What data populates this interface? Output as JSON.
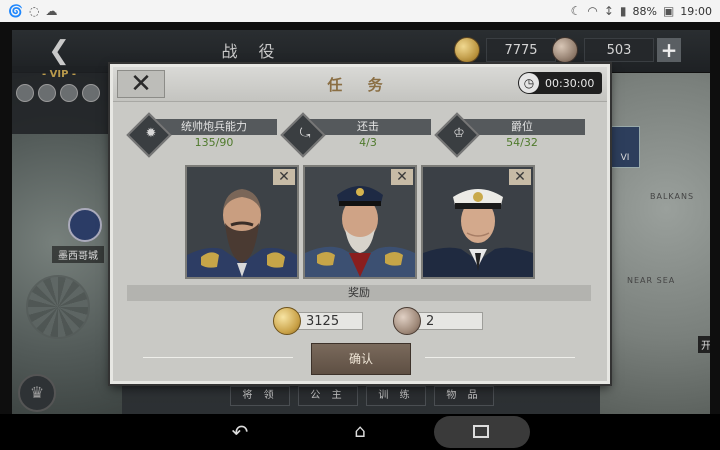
{
  "status_bar": {
    "battery": "88%",
    "time": "19:00"
  },
  "topbar": {
    "title": "战 役",
    "coins": "7775",
    "medals": "503",
    "plus_symbol": "+"
  },
  "vip": {
    "label": "- VIP -"
  },
  "map": {
    "city_label": "墨西哥城",
    "right_region": "BALKANS",
    "right_sea": "NEAR SEA",
    "right_badge": "VI",
    "right_label": "开"
  },
  "bottom_menu": [
    "将 领",
    "公 主",
    "训 练",
    "物 品"
  ],
  "dialog": {
    "title": "任 务",
    "timer": "00:30:00",
    "stats": [
      {
        "label": "统帅炮兵能力",
        "value": "135/90",
        "icon": "cannon-icon"
      },
      {
        "label": "还击",
        "value": "4/3",
        "icon": "counterattack-icon"
      },
      {
        "label": "爵位",
        "value": "54/32",
        "icon": "crown-icon"
      }
    ],
    "portraits": [
      {
        "name": "bearded-general",
        "close": "✕"
      },
      {
        "name": "white-bearded-officer",
        "close": "✕"
      },
      {
        "name": "naval-officer",
        "close": "✕"
      }
    ],
    "reward_heading": "奖励",
    "rewards": [
      {
        "type": "coin",
        "amount": "3125"
      },
      {
        "type": "medal",
        "amount": "2"
      }
    ],
    "confirm_label": "确认"
  }
}
